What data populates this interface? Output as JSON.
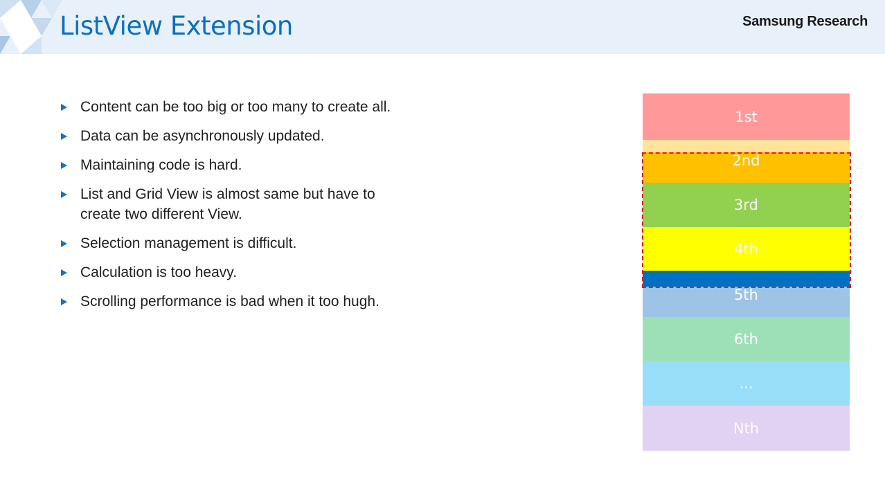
{
  "header": {
    "title": "ListView  Extension",
    "brand": "Samsung Research"
  },
  "bullets": [
    "Content can be too big or too many to create all.",
    "Data can be asynchronously updated.",
    "Maintaining code is hard.",
    "List and Grid View is almost same but have to create two different View.",
    "Selection management is difficult.",
    "Calculation is too heavy.",
    "Scrolling performance is bad when it too hugh."
  ],
  "list_items": [
    {
      "label": "1st",
      "color": "#ff9999"
    },
    {
      "label": "",
      "color": "#ffe49a"
    },
    {
      "label": "2nd",
      "color": "#ffc000"
    },
    {
      "label": "3rd",
      "color": "#92d050"
    },
    {
      "label": "4th",
      "color": "#ffff00"
    },
    {
      "label": "",
      "color": "#0070c0"
    },
    {
      "label": "5th",
      "color": "#9dc3e6"
    },
    {
      "label": "6th",
      "color": "#9de0b8"
    },
    {
      "label": "...",
      "color": "#99def8"
    },
    {
      "label": "Nth",
      "color": "#e1d1f2"
    }
  ],
  "colors": {
    "header_bg": "#e8f1fa",
    "title": "#0a6fc2",
    "bullet_marker": "#1572c4",
    "viewport_border": "#e01e1e"
  }
}
